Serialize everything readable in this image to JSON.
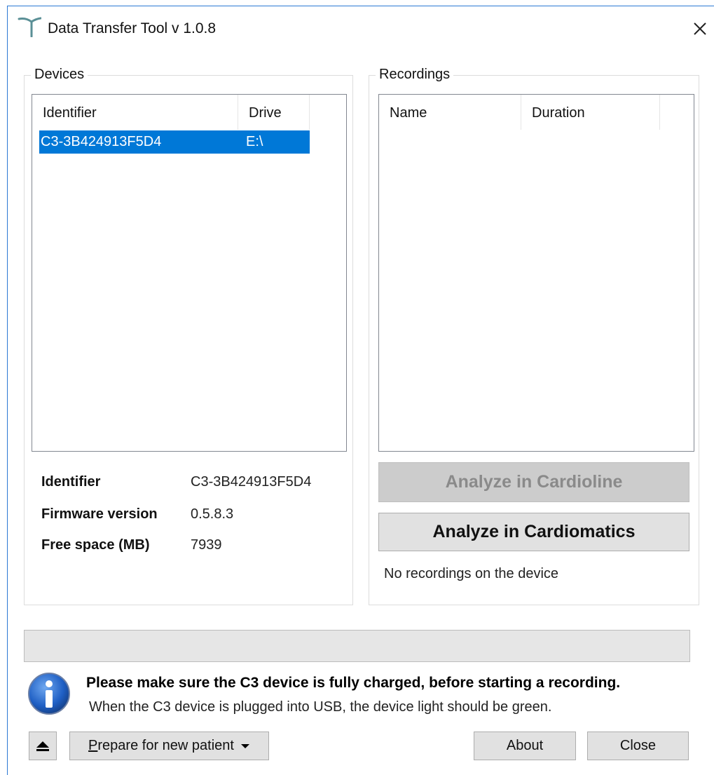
{
  "window": {
    "title": "Data Transfer Tool v 1.0.8"
  },
  "devices": {
    "group_label": "Devices",
    "columns": [
      "Identifier",
      "Drive"
    ],
    "rows": [
      {
        "identifier": "C3-3B424913F5D4",
        "drive": "E:\\",
        "selected": true
      }
    ],
    "info": {
      "identifier_label": "Identifier",
      "identifier_value": "C3-3B424913F5D4",
      "firmware_label": "Firmware version",
      "firmware_value": "0.5.8.3",
      "free_space_label": "Free space (MB)",
      "free_space_value": "7939"
    }
  },
  "recordings": {
    "group_label": "Recordings",
    "columns": [
      "Name",
      "Duration"
    ],
    "analyze_cardioline_label": "Analyze in Cardioline",
    "analyze_cardioline_enabled": false,
    "analyze_cardiomatics_label": "Analyze in Cardiomatics",
    "status": "No recordings on the device"
  },
  "progress": {
    "value": 0
  },
  "message": {
    "bold": "Please make sure the C3 device is fully charged, before starting a recording.",
    "normal": "When the C3 device is plugged into USB, the device light should be green."
  },
  "footer": {
    "eject_icon": "eject-icon",
    "prepare_first_letter": "P",
    "prepare_rest": "repare for new patient",
    "about_label": "About",
    "close_label": "Close"
  },
  "colors": {
    "selection": "#0078d7",
    "window_border": "#2b78d4",
    "button": "#e1e1e1",
    "button_disabled": "#cccccc"
  }
}
